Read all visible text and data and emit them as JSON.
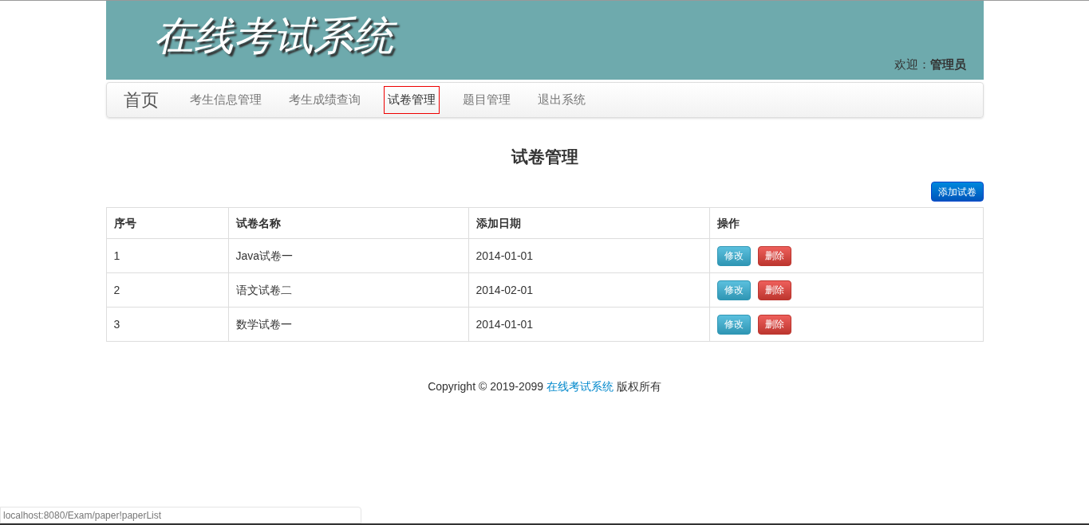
{
  "header": {
    "logo": "在线考试系统",
    "welcome_label": "欢迎：",
    "welcome_user": "管理员"
  },
  "nav": {
    "brand": "首页",
    "items": [
      {
        "label": "考生信息管理",
        "selected": false
      },
      {
        "label": "考生成绩查询",
        "selected": false
      },
      {
        "label": "试卷管理",
        "selected": true
      },
      {
        "label": "题目管理",
        "selected": false
      },
      {
        "label": "退出系统",
        "selected": false
      }
    ]
  },
  "page_title": "试卷管理",
  "add_button": "添加试卷",
  "table": {
    "columns": [
      "序号",
      "试卷名称",
      "添加日期",
      "操作"
    ],
    "rows": [
      {
        "cells": [
          "1",
          "Java试卷一",
          "2014-01-01"
        ],
        "actions": [
          "修改",
          "删除"
        ]
      },
      {
        "cells": [
          "2",
          "语文试卷二",
          "2014-02-01"
        ],
        "actions": [
          "修改",
          "删除"
        ]
      },
      {
        "cells": [
          "3",
          "数学试卷一",
          "2014-01-01"
        ],
        "actions": [
          "修改",
          "删除"
        ]
      }
    ]
  },
  "footer": {
    "before": "Copyright © 2019-2099 ",
    "link": "在线考试系统",
    "after": " 版权所有"
  },
  "status_bar": "localhost:8080/Exam/paper!paperList"
}
